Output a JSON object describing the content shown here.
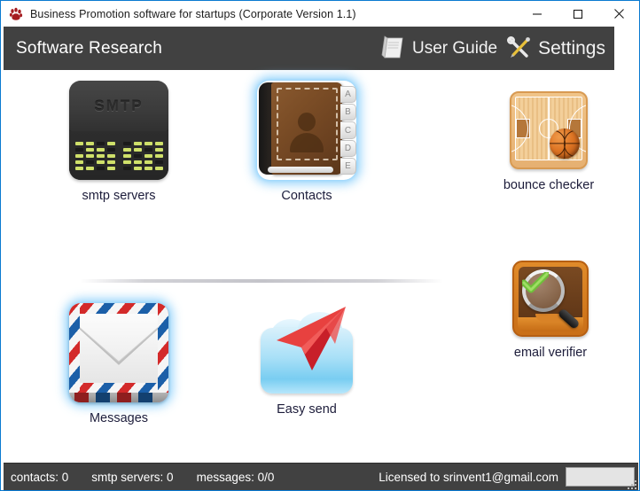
{
  "window": {
    "title": "Business Promotion software for startups  (Corporate Version 1.1)",
    "app_icon": "paw-logo-icon",
    "accent_color": "#0a7ad1",
    "controls": {
      "minimize": "minimize-button",
      "maximize": "maximize-button",
      "close": "close-button"
    }
  },
  "header": {
    "title": "Software Research",
    "background_color": "#414141",
    "actions": [
      {
        "id": "user-guide",
        "label": "User Guide",
        "icon": "book-icon"
      },
      {
        "id": "settings",
        "label": "Settings",
        "icon": "tools-icon"
      }
    ]
  },
  "main": {
    "tiles": [
      {
        "id": "smtp-servers",
        "label": "smtp servers",
        "icon": "smtp-server-icon",
        "selected": false,
        "badge_text": "SMTP"
      },
      {
        "id": "contacts",
        "label": "Contacts",
        "icon": "address-book-icon",
        "selected": true,
        "tabs": [
          "A",
          "B",
          "C",
          "D",
          "E"
        ]
      },
      {
        "id": "bounce-checker",
        "label": "bounce checker",
        "icon": "basketball-court-icon",
        "selected": false
      },
      {
        "id": "messages",
        "label": "Messages",
        "icon": "airmail-envelope-icon",
        "selected": true
      },
      {
        "id": "easy-send",
        "label": "Easy send",
        "icon": "paper-plane-cloud-icon",
        "selected": false
      },
      {
        "id": "email-verifier",
        "label": "email verifier",
        "icon": "magnifier-check-icon",
        "selected": false
      }
    ],
    "label_color": "#1c1c3a"
  },
  "statusbar": {
    "contacts": "contacts: 0",
    "smtp_servers": "smtp servers: 0",
    "messages": "messages: 0/0",
    "license": "Licensed to srinvent1@gmail.com",
    "background_color": "#414141"
  }
}
